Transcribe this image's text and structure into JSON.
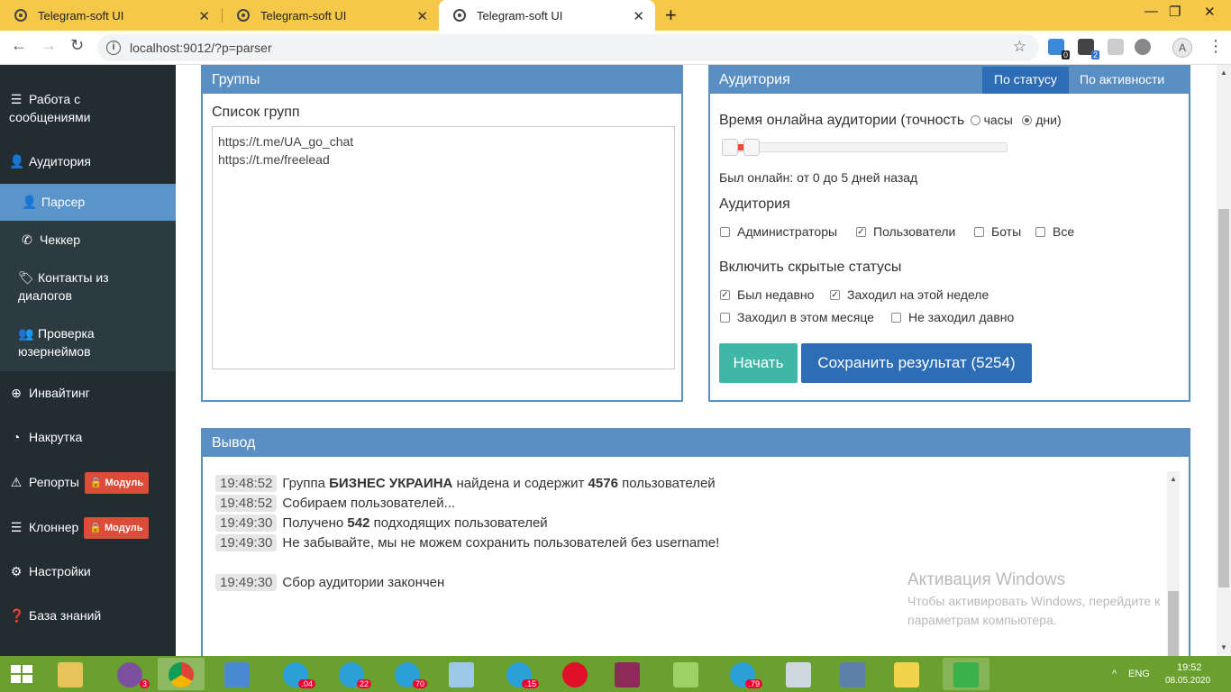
{
  "browser": {
    "tabs": [
      {
        "title": "Telegram-soft UI",
        "close": "✕"
      },
      {
        "title": "Telegram-soft UI",
        "close": "✕"
      },
      {
        "title": "Telegram-soft UI",
        "close": "✕"
      }
    ],
    "new_tab": "+",
    "window_controls": [
      "—",
      "❐",
      "✕"
    ],
    "url": "localhost:9012/?p=parser",
    "ext_badges": [
      "0",
      "2"
    ],
    "avatar_letter": "A"
  },
  "sidebar": {
    "items": [
      {
        "label_line1": "Работа с",
        "label_line2": "сообщениями",
        "icon": "inbox-icon"
      },
      {
        "label": "Аудитория",
        "icon": "user-icon"
      },
      {
        "label": "Парсер",
        "icon": "user-icon"
      },
      {
        "label": "Чеккер",
        "icon": "phone-icon"
      },
      {
        "label_line1": "Контакты из",
        "label_line2": "диалогов",
        "icon": "tags-icon"
      },
      {
        "label_line1": "Проверка",
        "label_line2": "юзернеймов",
        "icon": "users-icon"
      },
      {
        "label": "Инвайтинг",
        "icon": "plus-circle-icon"
      },
      {
        "label": "Накрутка",
        "icon": "dashboard-icon"
      },
      {
        "label": "Репорты",
        "badge": "Модуль",
        "icon": "warning-icon"
      },
      {
        "label": "Клоннер",
        "badge": "Модуль",
        "icon": "list-icon"
      },
      {
        "label": "Настройки",
        "icon": "gear-icon"
      },
      {
        "label": "База знаний",
        "icon": "question-icon"
      }
    ]
  },
  "groups": {
    "title": "Группы",
    "list_label": "Список групп",
    "links": "https://t.me/UA_go_chat\nhttps://t.me/freelead"
  },
  "audience": {
    "title": "Аудитория",
    "tabs": [
      "По статусу",
      "По активности"
    ],
    "online_label": "Время онлайна аудитории (точность",
    "unit_hours": "часы",
    "unit_days": "дни",
    "range_text": "Был онлайн: от 0 до 5 дней назад",
    "section_audience": "Аудитория",
    "types": [
      {
        "label": "Администраторы",
        "checked": false
      },
      {
        "label": "Пользователи",
        "checked": true
      },
      {
        "label": "Боты",
        "checked": false
      },
      {
        "label": "Все",
        "checked": false
      }
    ],
    "section_hidden": "Включить скрытые статусы",
    "statuses": [
      {
        "label": "Был недавно",
        "checked": true
      },
      {
        "label": "Заходил на этой неделе",
        "checked": true
      },
      {
        "label": "Заходил в этом месяце",
        "checked": false
      },
      {
        "label": "Не заходил давно",
        "checked": false
      }
    ],
    "start_button": "Начать",
    "save_button": "Сохранить результат (5254)"
  },
  "output": {
    "title": "Вывод",
    "log": [
      {
        "time": "19:48:52",
        "pre": "Группа ",
        "b1": "БИЗНЕС УКРАИНА",
        "mid": " найдена и содержит ",
        "b2": "4576",
        "post": " пользователей"
      },
      {
        "time": "19:48:52",
        "pre": "Собираем пользователей...",
        "b1": "",
        "mid": "",
        "b2": "",
        "post": ""
      },
      {
        "time": "19:49:30",
        "pre": "Получено ",
        "b1": "542",
        "mid": " подходящих пользователей",
        "b2": "",
        "post": ""
      },
      {
        "time": "19:49:30",
        "pre": "Не забывайте, мы не можем сохранить пользователей без username!",
        "b1": "",
        "mid": "",
        "b2": "",
        "post": ""
      },
      {
        "time": "19:49:30",
        "pre": "Сбор аудитории закончен",
        "b1": "",
        "mid": "",
        "b2": "",
        "post": ""
      }
    ],
    "watermark_title": "Активация Windows",
    "watermark_text": "Чтобы активировать Windows, перейдите к параметрам компьютера."
  },
  "taskbar": {
    "badges": [
      "3",
      ".04",
      "22",
      "70",
      ".15",
      ".79"
    ],
    "lang": "ENG",
    "time": "19:52",
    "date": "08.05.2020",
    "show_hidden": "^"
  }
}
